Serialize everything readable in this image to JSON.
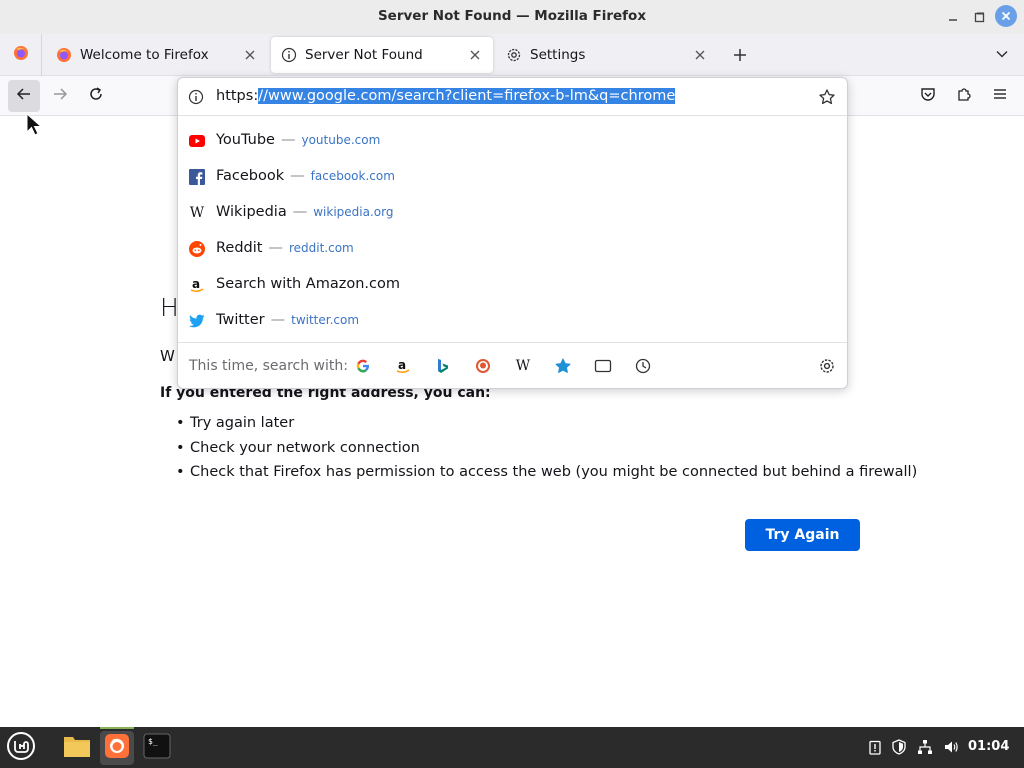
{
  "window": {
    "title": "Server Not Found — Mozilla Firefox"
  },
  "tabs": [
    {
      "label": "Welcome to Firefox",
      "active": false
    },
    {
      "label": "Server Not Found",
      "active": true
    },
    {
      "label": "Settings",
      "active": false
    }
  ],
  "urlbar": {
    "url_prefix": "https:",
    "url_selected": "//www.google.com/search?client=firefox-b-lm&q=chrome"
  },
  "suggestions": [
    {
      "title": "YouTube",
      "url": "youtube.com",
      "icon": "youtube-icon"
    },
    {
      "title": "Facebook",
      "url": "facebook.com",
      "icon": "facebook-icon"
    },
    {
      "title": "Wikipedia",
      "url": "wikipedia.org",
      "icon": "wikipedia-icon"
    },
    {
      "title": "Reddit",
      "url": "reddit.com",
      "icon": "reddit-icon"
    },
    {
      "title": "Search with Amazon.com",
      "url": "",
      "icon": "amazon-icon"
    },
    {
      "title": "Twitter",
      "url": "twitter.com",
      "icon": "twitter-icon"
    }
  ],
  "oneoff": {
    "label": "This time, search with:",
    "engines": [
      "google-icon",
      "amazon-icon",
      "bing-icon",
      "duckduckgo-icon",
      "wikipedia-icon",
      "bookmarks-icon",
      "tabs-icon",
      "history-icon"
    ]
  },
  "error_page": {
    "title_visible": "H",
    "subtitle_visible": "W",
    "bold_heading": "If you entered the right address, you can:",
    "items": [
      "Try again later",
      "Check your network connection",
      "Check that Firefox has permission to access the web (you might be connected but behind a firewall)"
    ],
    "try_again_label": "Try Again"
  },
  "taskbar": {
    "clock": "01:04"
  },
  "colors": {
    "accent": "#0061e0",
    "selection": "#3584e4",
    "taskbar": "#2b2b2b"
  }
}
